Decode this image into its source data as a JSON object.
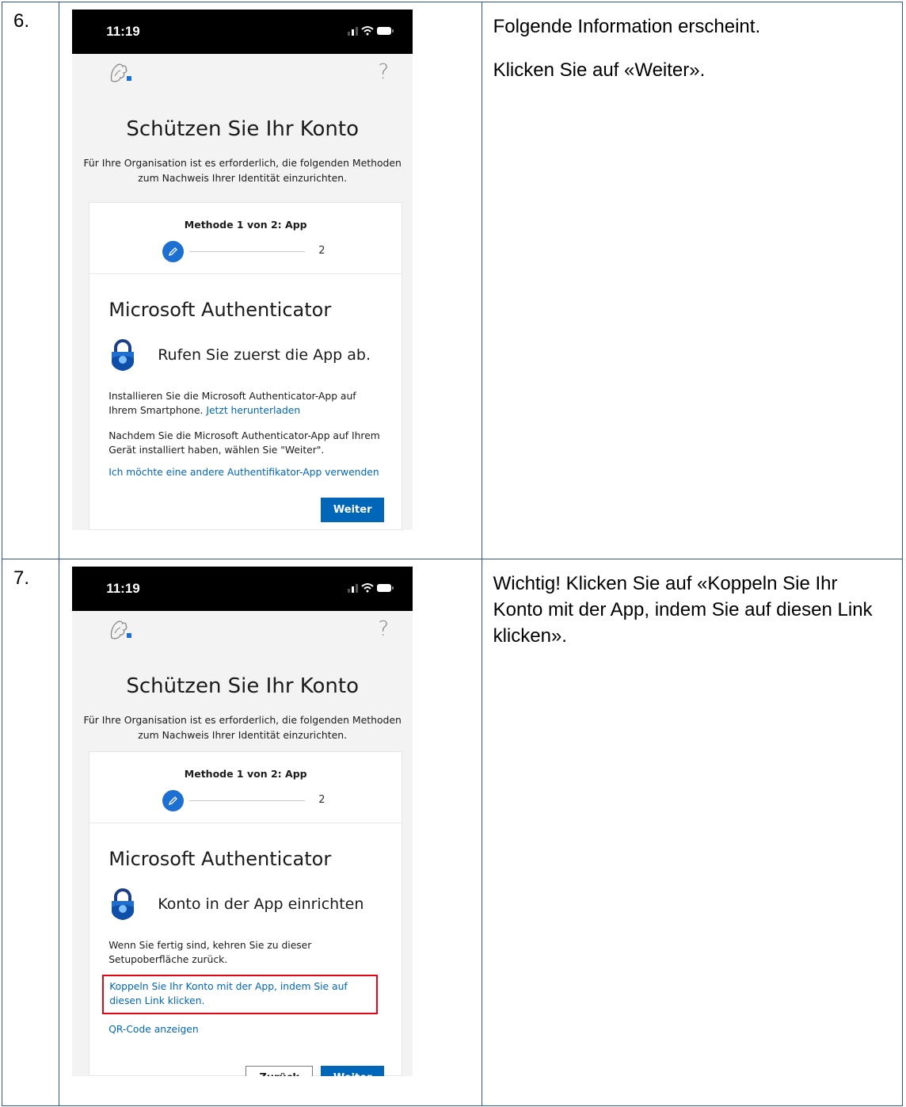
{
  "steps": [
    {
      "number": "6.",
      "instructions": [
        "Folgende Information erscheint.",
        "Klicken Sie auf «Weiter»."
      ],
      "phone": {
        "time": "11:19",
        "help": "?",
        "title": "Schützen Sie Ihr Konto",
        "subtitle": "Für Ihre Organisation ist es erforderlich, die folgenden Methoden zum Nachweis Ihrer Identität einzurichten.",
        "method_label": "Methode 1 von 2: App",
        "step_two": "2",
        "auth_title": "Microsoft Authenticator",
        "auth_heading": "Rufen Sie zuerst die App ab.",
        "para1_text": "Installieren Sie die Microsoft Authenticator-App auf Ihrem Smartphone.",
        "para1_link": "Jetzt herunterladen",
        "para2": "Nachdem Sie die Microsoft Authenticator-App auf Ihrem Gerät installiert haben, wählen Sie \"Weiter\".",
        "alt_link": "Ich möchte eine andere Authentifikator-App verwenden",
        "next_button": "Weiter"
      }
    },
    {
      "number": "7.",
      "instructions": [
        "Wichtig! Klicken Sie auf «Koppeln Sie Ihr Konto mit der App, indem Sie auf diesen Link klicken»."
      ],
      "phone": {
        "time": "11:19",
        "help": "?",
        "title": "Schützen Sie Ihr Konto",
        "subtitle": "Für Ihre Organisation ist es erforderlich, die folgenden Methoden zum Nachweis Ihrer Identität einzurichten.",
        "method_label": "Methode 1 von 2: App",
        "step_two": "2",
        "auth_title": "Microsoft Authenticator",
        "auth_heading": "Konto in der App einrichten",
        "para1": "Wenn Sie fertig sind, kehren Sie zu dieser Setupoberfläche zurück.",
        "pair_link": "Koppeln Sie Ihr Konto mit der App, indem Sie auf diesen Link klicken.",
        "qr_link": "QR-Code anzeigen",
        "back_button": "Zurück",
        "next_button": "Weiter"
      }
    }
  ],
  "colors": {
    "table_border": "#2f5597",
    "ms_blue": "#0067b8",
    "highlight_red": "#e30613"
  }
}
